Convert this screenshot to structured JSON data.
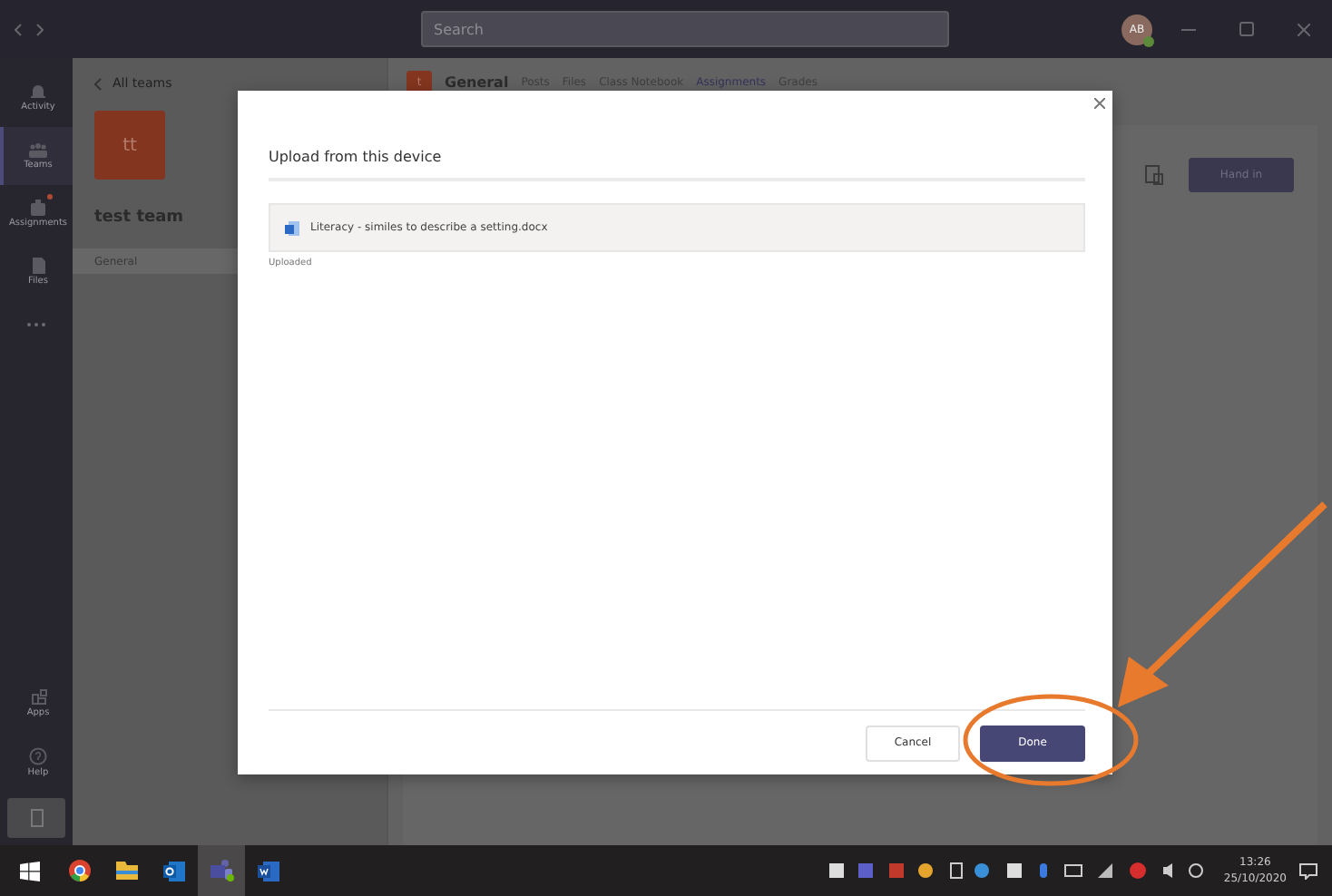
{
  "title_bar": {
    "search": {
      "placeholder": "Search"
    },
    "avatar": "AB"
  },
  "rail": {
    "top": [
      {
        "label": "Activity",
        "selected": false,
        "badge": false
      },
      {
        "label": "Teams",
        "selected": true,
        "badge": false
      },
      {
        "label": "Assignments",
        "selected": false,
        "badge": true
      },
      {
        "label": "Files",
        "selected": false,
        "badge": false
      }
    ],
    "bottom": [
      {
        "label": "Apps",
        "selected": false,
        "badge": false
      },
      {
        "label": "Help",
        "selected": false,
        "badge": false
      }
    ]
  },
  "team_panel": {
    "back": "All teams",
    "initials": "tt",
    "name": "test team",
    "channels": [
      {
        "label": "General",
        "selected": true
      }
    ]
  },
  "channel_header": {
    "initial": "t",
    "name": "General",
    "tabs": [
      {
        "label": "Posts",
        "selected": false
      },
      {
        "label": "Files",
        "selected": false
      },
      {
        "label": "Class Notebook",
        "selected": false
      },
      {
        "label": "Assignments",
        "selected": true
      },
      {
        "label": "Grades",
        "selected": false
      }
    ]
  },
  "hand_in": "Hand in",
  "dialog": {
    "title": "Upload from this device",
    "files": [
      {
        "name": "Literacy - similes to describe a setting.docx",
        "status": "Uploaded"
      }
    ],
    "buttons": [
      {
        "label": "Cancel",
        "kind": "secondary"
      },
      {
        "label": "Done",
        "kind": "primary"
      }
    ]
  },
  "taskbar": {
    "apps": [
      {
        "selected": false
      },
      {
        "selected": false
      },
      {
        "selected": false
      },
      {
        "selected": true
      },
      {
        "selected": false
      }
    ],
    "time": "13:26",
    "date": "25/10/2020"
  }
}
